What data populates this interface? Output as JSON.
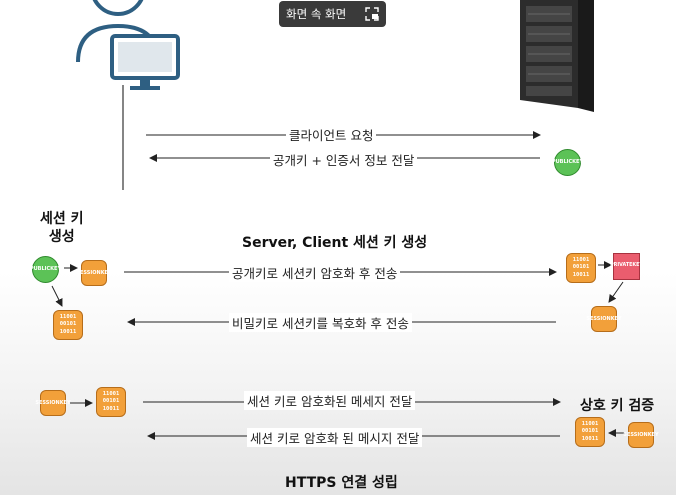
{
  "overlay": {
    "pip_label": "화면 속 화면",
    "icon": "picture-in-picture-icon"
  },
  "flow": {
    "client_request": "클라이언트 요청",
    "server_response": "공개키 + 인증서 정보 전달",
    "session_key_title_line1": "세션 키",
    "session_key_title_line2": "생성",
    "session_phase_title": "Server, Client 세션 키 생성",
    "encrypt_session_key": "공개키로 세션키 암호화 후 전송",
    "decrypt_session_key": "비밀키로 세션키를 복호화 후 전송",
    "send_encrypted_message": "세션 키로 암호화된 메세지 전달",
    "mutual_verification": "상호 키 검증",
    "reply_encrypted_message": "세션 키로 암호화 된 메시지 전달",
    "footer": "HTTPS 연결 성립"
  },
  "badges": {
    "public_key": [
      "PUBLIC",
      "KEY"
    ],
    "private_key": [
      "PRIVATE",
      "KEY"
    ],
    "session_key": [
      "SESSION",
      "KEY"
    ],
    "binary": "11001\n00101\n10011"
  },
  "colors": {
    "client_icon": "#2e5f82",
    "public_key": "#5cc257",
    "private_key": "#ea5d6e",
    "session_key": "#f2a03a"
  }
}
